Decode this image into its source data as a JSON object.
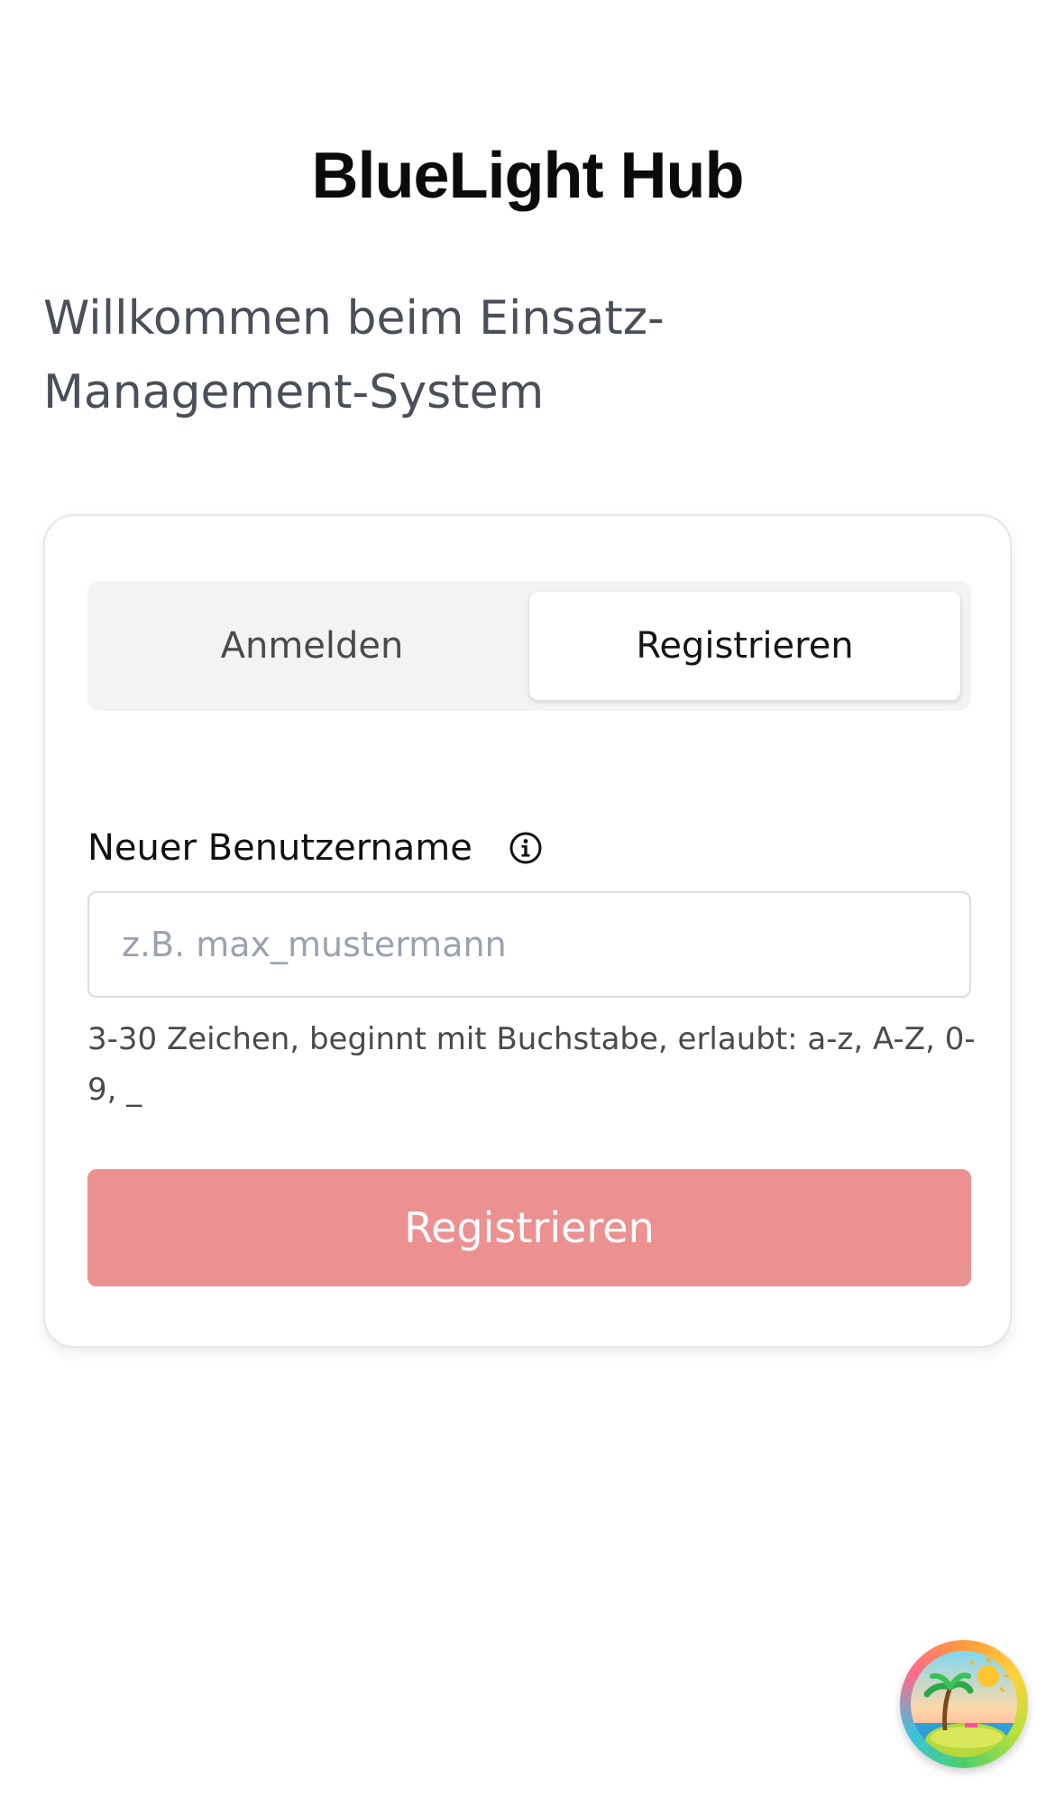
{
  "app": {
    "title": "BlueLight Hub",
    "subtitle": "Willkommen beim Einsatz-Management-System"
  },
  "tabs": {
    "login_label": "Anmelden",
    "register_label": "Registrieren",
    "active": "register"
  },
  "form": {
    "username_label": "Neuer Benutzername",
    "username_placeholder": "z.B. max_mustermann",
    "username_value": "",
    "username_hint": "3-30 Zeichen, beginnt mit Buchstabe, erlaubt: a-z, A-Z, 0-9, _",
    "submit_label": "Registrieren"
  },
  "icons": {
    "info": "info-icon",
    "fab": "island-avatar-icon"
  },
  "colors": {
    "submit_bg": "#eb9191",
    "tab_bg": "#f3f3f3",
    "card_border": "#e6e6e6"
  }
}
